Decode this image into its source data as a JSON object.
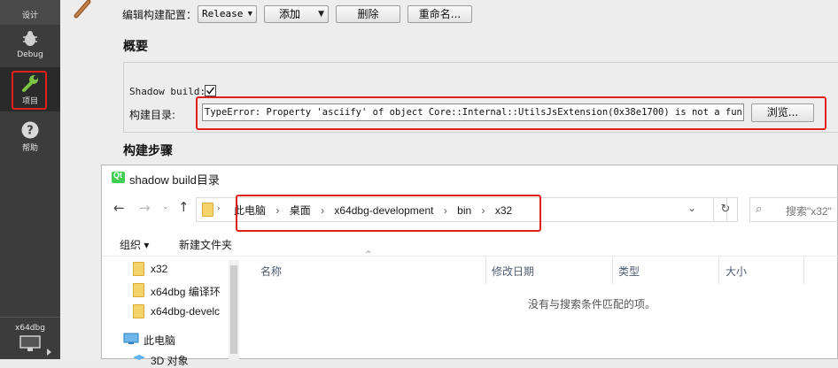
{
  "sidebar": {
    "modes": [
      {
        "label": "设计",
        "icon": "design-icon"
      },
      {
        "label": "Debug",
        "icon": "debug-bug-icon"
      },
      {
        "label": "项目",
        "icon": "project-wrench-icon"
      },
      {
        "label": "帮助",
        "icon": "help-icon"
      }
    ],
    "kit": {
      "label": "x64dbg",
      "icon": "monitor-icon"
    }
  },
  "build": {
    "config_label": "编辑构建配置：",
    "config_value": "Release",
    "add_label": "添加",
    "delete_label": "删除",
    "rename_label": "重命名...",
    "overview_title": "概要",
    "shadow_label": "Shadow build:",
    "shadow_checked": true,
    "dir_label": "构建目录:",
    "dir_value": "TypeError: Property 'asciify' of object Core::Internal::UtilsJsExtension(0x38e1700) is not a function",
    "browse_label": "浏览...",
    "steps_title": "构建步骤"
  },
  "dialog": {
    "title": "shadow build目录",
    "breadcrumb": [
      "此电脑",
      "桌面",
      "x64dbg-development",
      "bin",
      "x32"
    ],
    "search_placeholder": "搜索\"x32\"",
    "toolbar": {
      "organize": "组织 ▾",
      "new_folder": "新建文件夹"
    },
    "tree": [
      {
        "label": "x32",
        "icon": "folder-icon"
      },
      {
        "label": "x64dbg 编译环",
        "icon": "folder-icon"
      },
      {
        "label": "x64dbg-develc",
        "icon": "folder-icon"
      },
      {
        "label": "此电脑",
        "icon": "computer-icon"
      },
      {
        "label": "3D 对象",
        "icon": "3d-objects-icon"
      }
    ],
    "columns": [
      "名称",
      "修改日期",
      "类型",
      "大小"
    ],
    "empty_text": "没有与搜索条件匹配的项。"
  },
  "colors": {
    "highlight": "#e0201b",
    "sidebar": "#3c3c3c",
    "wrench": "#7cc243"
  }
}
